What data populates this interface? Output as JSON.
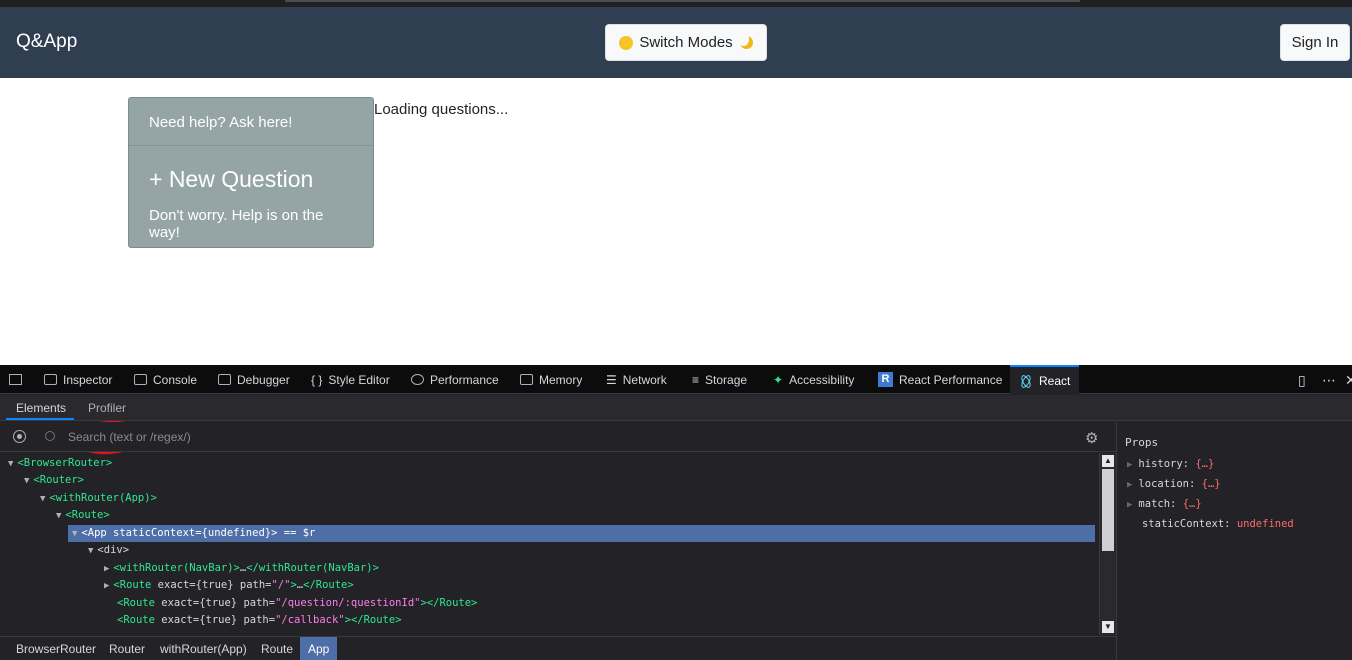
{
  "app": {
    "brand": "Q&App",
    "switch_modes_label": "Switch Modes",
    "sign_in_label": "Sign In",
    "card": {
      "header": "Need help? Ask here!",
      "title": "+ New Question",
      "text": "Don't worry. Help is on the way!"
    },
    "loading_text": "Loading questions..."
  },
  "devtools": {
    "tabs": [
      {
        "label": "Inspector",
        "icon": "inspector-icon"
      },
      {
        "label": "Console",
        "icon": "console-icon"
      },
      {
        "label": "Debugger",
        "icon": "debugger-icon"
      },
      {
        "label": "Style Editor",
        "icon": "braces-icon"
      },
      {
        "label": "Performance",
        "icon": "performance-icon"
      },
      {
        "label": "Memory",
        "icon": "memory-icon"
      },
      {
        "label": "Network",
        "icon": "network-icon"
      },
      {
        "label": "Storage",
        "icon": "storage-icon"
      },
      {
        "label": "Accessibility",
        "icon": "accessibility-icon"
      },
      {
        "label": "React Performance",
        "icon": "r-badge-icon"
      },
      {
        "label": "React",
        "icon": "react-atom-icon"
      }
    ],
    "active_tab": "React",
    "subtabs": {
      "elements": "Elements",
      "profiler": "Profiler"
    },
    "search": {
      "placeholder": "Search (text or /regex/)"
    },
    "tree": {
      "r0": {
        "arrow": "▼",
        "tag": "<BrowserRouter>"
      },
      "r1": {
        "arrow": "▼",
        "tag": "<Router>"
      },
      "r2": {
        "arrow": "▼",
        "tag": "<withRouter(App)>"
      },
      "r3": {
        "arrow": "▼",
        "tag": "<Route>"
      },
      "r4": {
        "arrow": "▼",
        "tag_open": "<App",
        "attr": " staticContext=",
        "val": "{undefined}",
        "tag_close": ">",
        "suffix": " == $r"
      },
      "r5": {
        "arrow": "▼",
        "tag": "<div>"
      },
      "r6": {
        "arrow": "▶",
        "tag_open": "<withRouter(NavBar)>",
        "mid": "…",
        "tag_close": "</withRouter(NavBar)>"
      },
      "r7": {
        "arrow": "▶",
        "tag_open": "<Route",
        "attr1": " exact=",
        "val1": "{true}",
        "attr2": " path=",
        "val2": "\"/\"",
        "gt": ">",
        "mid": "…",
        "tag_close": "</Route>"
      },
      "r8": {
        "tag_open": "<Route",
        "attr1": " exact=",
        "val1": "{true}",
        "attr2": " path=",
        "val2": "\"/question/:questionId\"",
        "tag_close": "></Route>"
      },
      "r9": {
        "tag_open": "<Route",
        "attr1": " exact=",
        "val1": "{true}",
        "attr2": " path=",
        "val2": "\"/callback\"",
        "tag_close": "></Route>"
      }
    },
    "props": {
      "title": "Props",
      "items": [
        {
          "key": "history:",
          "value": "{…}",
          "expandable": "▶"
        },
        {
          "key": "location:",
          "value": "{…}",
          "expandable": "▶"
        },
        {
          "key": "match:",
          "value": "{…}",
          "expandable": "▶"
        },
        {
          "key": "staticContext:",
          "value": "undefined",
          "expandable": ""
        }
      ]
    },
    "breadcrumbs": [
      "BrowserRouter",
      "Router",
      "withRouter(App)",
      "Route",
      "App"
    ]
  }
}
